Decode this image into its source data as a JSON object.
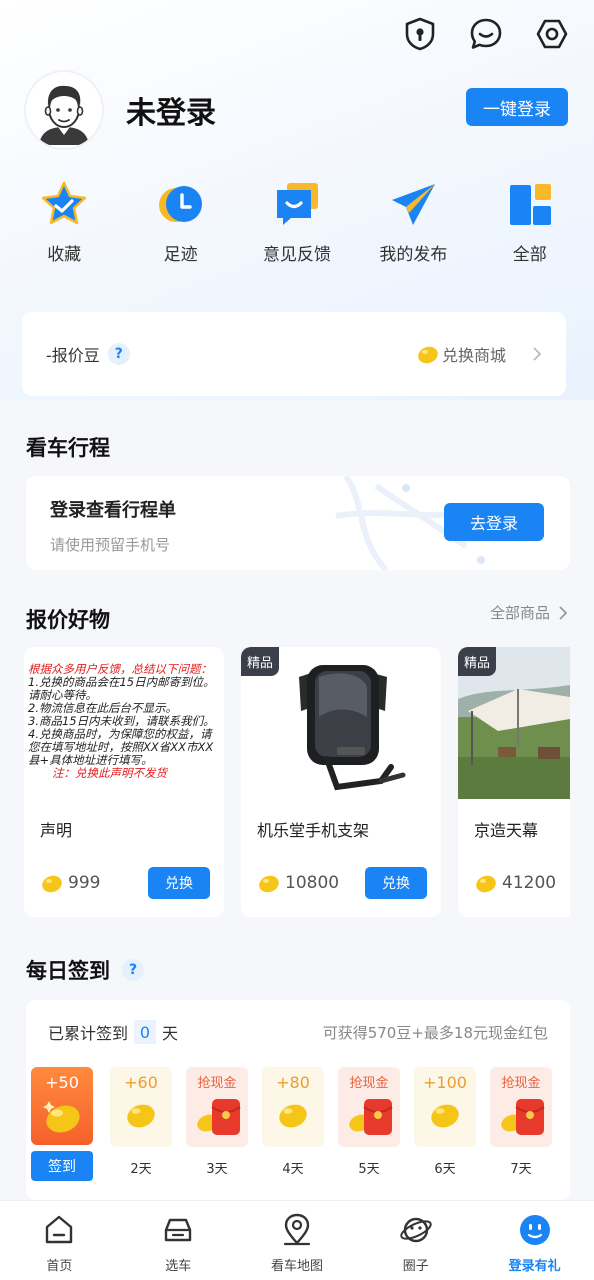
{
  "header": {
    "icons": [
      "shield-lock-icon",
      "chat-icon",
      "settings-icon"
    ],
    "username": "未登录",
    "login_button": "一键登录"
  },
  "quick_actions": [
    {
      "label": "收藏",
      "icon": "star-icon"
    },
    {
      "label": "足迹",
      "icon": "clock-icon"
    },
    {
      "label": "意见反馈",
      "icon": "feedback-icon"
    },
    {
      "label": "我的发布",
      "icon": "send-icon"
    },
    {
      "label": "全部",
      "icon": "grid-icon"
    }
  ],
  "beans": {
    "label": "-报价豆",
    "help": "?",
    "shop_label": "兑换商城"
  },
  "trip": {
    "section_title": "看车行程",
    "title": "登录查看行程单",
    "subtitle": "请使用预留手机号",
    "button": "去登录"
  },
  "goods": {
    "section_title": "报价好物",
    "more_label": "全部商品",
    "tag_label": "精品",
    "items": [
      {
        "name": "声明",
        "price": "999",
        "button": "兑换",
        "notice": [
          "根据众多用户反馈，总结以下问题：",
          "1.兑换的商品会在15日内邮寄到位。请耐心等待。",
          "2.物流信息在此后台不显示。",
          "3.商品15日内未收到，请联系我们。",
          "4.兑换商品时，为保障您的权益，请您在填写地址时，按照XX省XX市XX县+具体地址进行填写。",
          "注：兑换此声明不发货"
        ]
      },
      {
        "name": "机乐堂手机支架",
        "price": "10800",
        "button": "兑换"
      },
      {
        "name": "京造天幕",
        "price": "41200"
      }
    ]
  },
  "checkin": {
    "section_title": "每日签到",
    "help": "?",
    "prefix": "已累计签到",
    "count": "0",
    "suffix": "天",
    "reward_text": "可获得570豆+最多18元现金红包",
    "sign_button": "签到",
    "days": [
      {
        "amount": "+50",
        "label": "签到",
        "kind": "first"
      },
      {
        "amount": "+60",
        "label": "2天",
        "kind": "bean"
      },
      {
        "amount": "抢现金",
        "label": "3天",
        "kind": "cash"
      },
      {
        "amount": "+80",
        "label": "4天",
        "kind": "bean"
      },
      {
        "amount": "抢现金",
        "label": "5天",
        "kind": "cash"
      },
      {
        "amount": "+100",
        "label": "6天",
        "kind": "bean"
      },
      {
        "amount": "抢现金",
        "label": "7天",
        "kind": "cash"
      }
    ]
  },
  "bottom_nav": [
    {
      "label": "首页",
      "icon": "home-icon"
    },
    {
      "label": "选车",
      "icon": "car-icon"
    },
    {
      "label": "看车地图",
      "icon": "map-pin-icon"
    },
    {
      "label": "圈子",
      "icon": "planet-icon"
    },
    {
      "label": "登录有礼",
      "icon": "profile-face-icon",
      "active": true
    }
  ],
  "colors": {
    "accent": "#1a84f4",
    "bean": "#f5c518",
    "cash": "#e8623f"
  }
}
